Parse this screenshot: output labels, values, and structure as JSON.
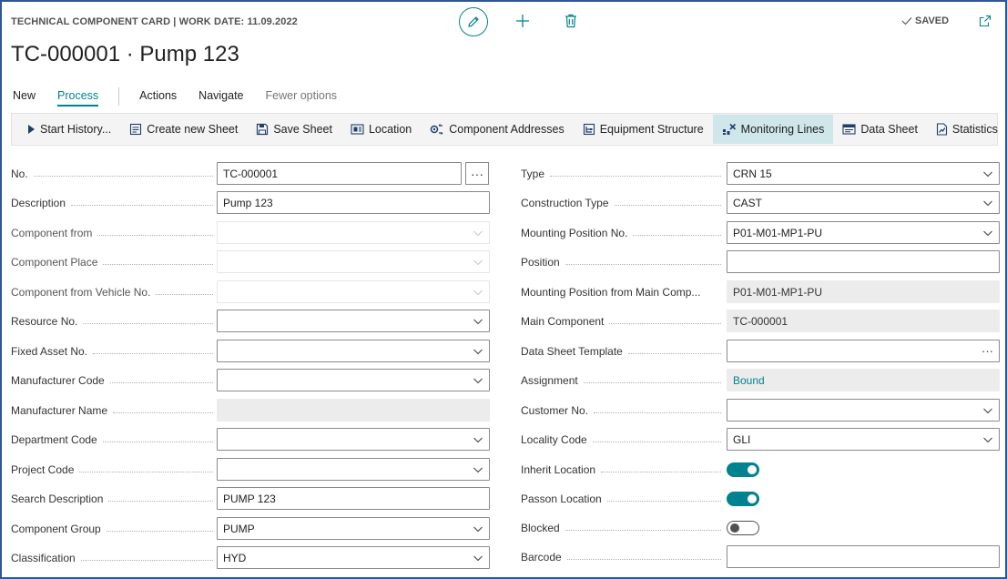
{
  "header": {
    "caption": "TECHNICAL COMPONENT CARD | WORK DATE: 11.09.2022",
    "title": "TC-000001 · Pump 123",
    "saved_label": "SAVED"
  },
  "action_tabs": [
    {
      "label": "New",
      "state": "normal"
    },
    {
      "label": "Process",
      "state": "active"
    },
    {
      "label": "Actions",
      "state": "normal"
    },
    {
      "label": "Navigate",
      "state": "normal"
    },
    {
      "label": "Fewer options",
      "state": "muted"
    }
  ],
  "toolbar": [
    {
      "label": "Start History...",
      "icon": "play-icon"
    },
    {
      "label": "Create new Sheet",
      "icon": "new-sheet-icon"
    },
    {
      "label": "Save Sheet",
      "icon": "save-icon"
    },
    {
      "label": "Location",
      "icon": "location-icon"
    },
    {
      "label": "Component Addresses",
      "icon": "addresses-icon"
    },
    {
      "label": "Equipment Structure",
      "icon": "structure-icon"
    },
    {
      "label": "Monitoring Lines",
      "icon": "monitoring-icon",
      "active": true
    },
    {
      "label": "Data Sheet",
      "icon": "data-sheet-icon"
    },
    {
      "label": "Statistics",
      "icon": "statistics-icon"
    }
  ],
  "left_fields": [
    {
      "label": "No.",
      "value": "TC-000001",
      "kind": "assist"
    },
    {
      "label": "Description",
      "value": "Pump 123",
      "kind": "text"
    },
    {
      "label": "Component from",
      "value": "",
      "kind": "dropdown-disabled"
    },
    {
      "label": "Component Place",
      "value": "",
      "kind": "dropdown-disabled"
    },
    {
      "label": "Component from Vehicle No.",
      "value": "",
      "kind": "dropdown-disabled"
    },
    {
      "label": "Resource No.",
      "value": "",
      "kind": "dropdown"
    },
    {
      "label": "Fixed Asset No.",
      "value": "",
      "kind": "dropdown"
    },
    {
      "label": "Manufacturer Code",
      "value": "",
      "kind": "dropdown"
    },
    {
      "label": "Manufacturer Name",
      "value": "",
      "kind": "readonly"
    },
    {
      "label": "Department Code",
      "value": "",
      "kind": "dropdown"
    },
    {
      "label": "Project Code",
      "value": "",
      "kind": "dropdown"
    },
    {
      "label": "Search Description",
      "value": "PUMP 123",
      "kind": "text"
    },
    {
      "label": "Component Group",
      "value": "PUMP",
      "kind": "dropdown"
    },
    {
      "label": "Classification",
      "value": "HYD",
      "kind": "dropdown"
    }
  ],
  "right_fields": [
    {
      "label": "Type",
      "value": "CRN 15",
      "kind": "dropdown"
    },
    {
      "label": "Construction Type",
      "value": "CAST",
      "kind": "dropdown"
    },
    {
      "label": "Mounting Position No.",
      "value": "P01-M01-MP1-PU",
      "kind": "dropdown"
    },
    {
      "label": "Position",
      "value": "",
      "kind": "text"
    },
    {
      "label": "Mounting Position from Main Comp...",
      "value": "P01-M01-MP1-PU",
      "kind": "readonly"
    },
    {
      "label": "Main Component",
      "value": "TC-000001",
      "kind": "readonly"
    },
    {
      "label": "Data Sheet Template",
      "value": "",
      "kind": "lookup"
    },
    {
      "label": "Assignment",
      "value": "Bound",
      "kind": "readonly-link"
    },
    {
      "label": "Customer No.",
      "value": "",
      "kind": "dropdown"
    },
    {
      "label": "Locality Code",
      "value": "GLI",
      "kind": "dropdown"
    },
    {
      "label": "Inherit Location",
      "value": true,
      "kind": "toggle"
    },
    {
      "label": "Passon Location",
      "value": true,
      "kind": "toggle"
    },
    {
      "label": "Blocked",
      "value": false,
      "kind": "toggle"
    },
    {
      "label": "Barcode",
      "value": "",
      "kind": "text"
    }
  ],
  "colors": {
    "accent": "#00838f",
    "frame": "#2f5597",
    "toolbar_active": "#cfe7ea"
  }
}
